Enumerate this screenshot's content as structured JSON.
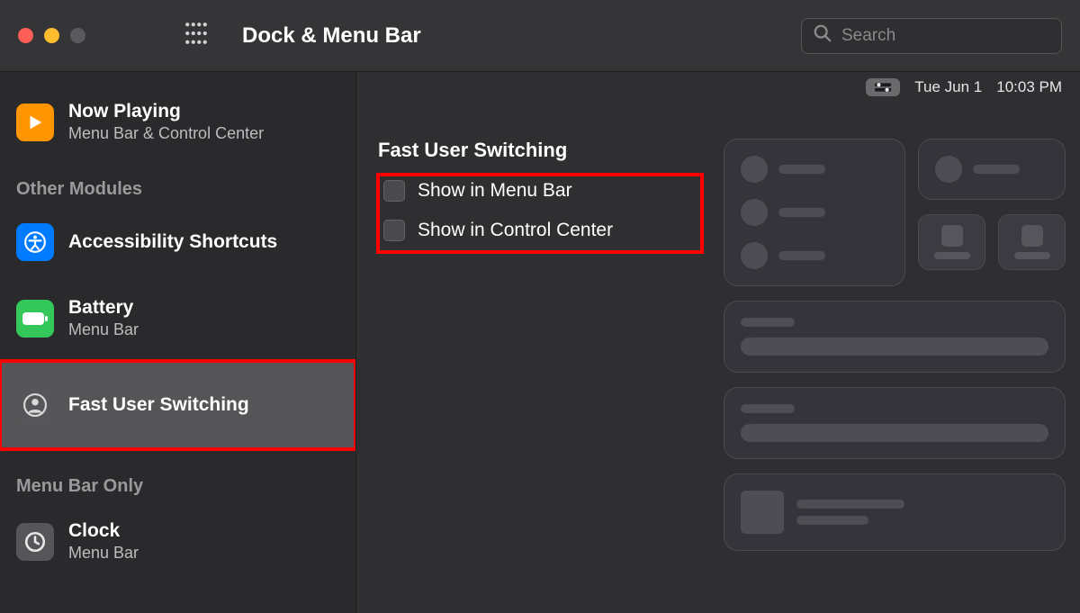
{
  "window": {
    "title": "Dock & Menu Bar",
    "search_placeholder": "Search"
  },
  "status": {
    "date": "Tue Jun 1",
    "time": "10:03 PM"
  },
  "sidebar": {
    "top_item": {
      "title": "Now Playing",
      "subtitle": "Menu Bar & Control Center"
    },
    "section_other_modules": "Other Modules",
    "accessibility": {
      "title": "Accessibility Shortcuts"
    },
    "battery": {
      "title": "Battery",
      "subtitle": "Menu Bar"
    },
    "fast_user_switching": {
      "title": "Fast User Switching"
    },
    "section_menu_bar_only": "Menu Bar Only",
    "clock": {
      "title": "Clock",
      "subtitle": "Menu Bar"
    }
  },
  "detail": {
    "heading": "Fast User Switching",
    "option_menu_bar": {
      "label": "Show in Menu Bar",
      "checked": false
    },
    "option_control_center": {
      "label": "Show in Control Center",
      "checked": false
    }
  }
}
